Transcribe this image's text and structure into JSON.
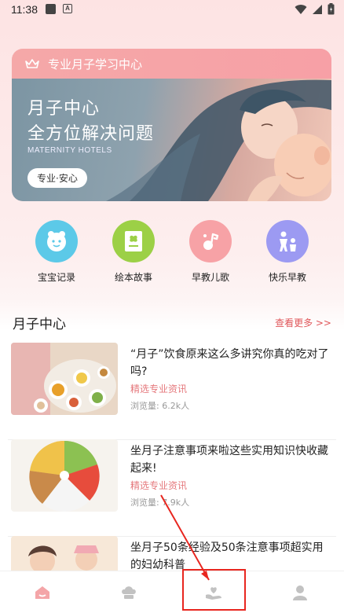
{
  "status_bar": {
    "time": "11:38",
    "notif_b": "A"
  },
  "banner": {
    "header_title": "专业月子学习中心",
    "line1": "月子中心",
    "line2": "全方位解决问题",
    "subtitle_en": "MATERNITY HOTELS",
    "pill": "专业·安心"
  },
  "quick_links": [
    {
      "label": "宝宝记录",
      "icon": "baby-face-icon",
      "color": "#5cc9e8"
    },
    {
      "label": "绘本故事",
      "icon": "picture-book-icon",
      "color": "#9cd046"
    },
    {
      "label": "早教儿歌",
      "icon": "music-note-icon",
      "color": "#f7a2a6"
    },
    {
      "label": "快乐早教",
      "icon": "kids-play-icon",
      "color": "#9c9af2"
    }
  ],
  "section": {
    "title": "月子中心",
    "more": "查看更多 >>"
  },
  "articles": [
    {
      "title": "“月子”饮食原来这么多讲究你真的吃对了吗?",
      "tag": "精选专业资讯",
      "views": "浏览量: 6.2k人"
    },
    {
      "title": "坐月子注意事项来啦这些实用知识快收藏起来!",
      "tag": "精选专业资讯",
      "views": "浏览量: 7.9k人"
    },
    {
      "title": "坐月子50条经验及50条注意事项超实用的妇幼科普",
      "tag": "",
      "views": ""
    }
  ],
  "bottom_nav": [
    {
      "name": "home-icon"
    },
    {
      "name": "chef-hat-icon"
    },
    {
      "name": "heart-hand-icon"
    },
    {
      "name": "profile-icon"
    }
  ],
  "colors": {
    "accent": "#f29aa0",
    "more_link": "#e0575a",
    "tag": "#e5787c",
    "highlight": "#e8261f"
  }
}
